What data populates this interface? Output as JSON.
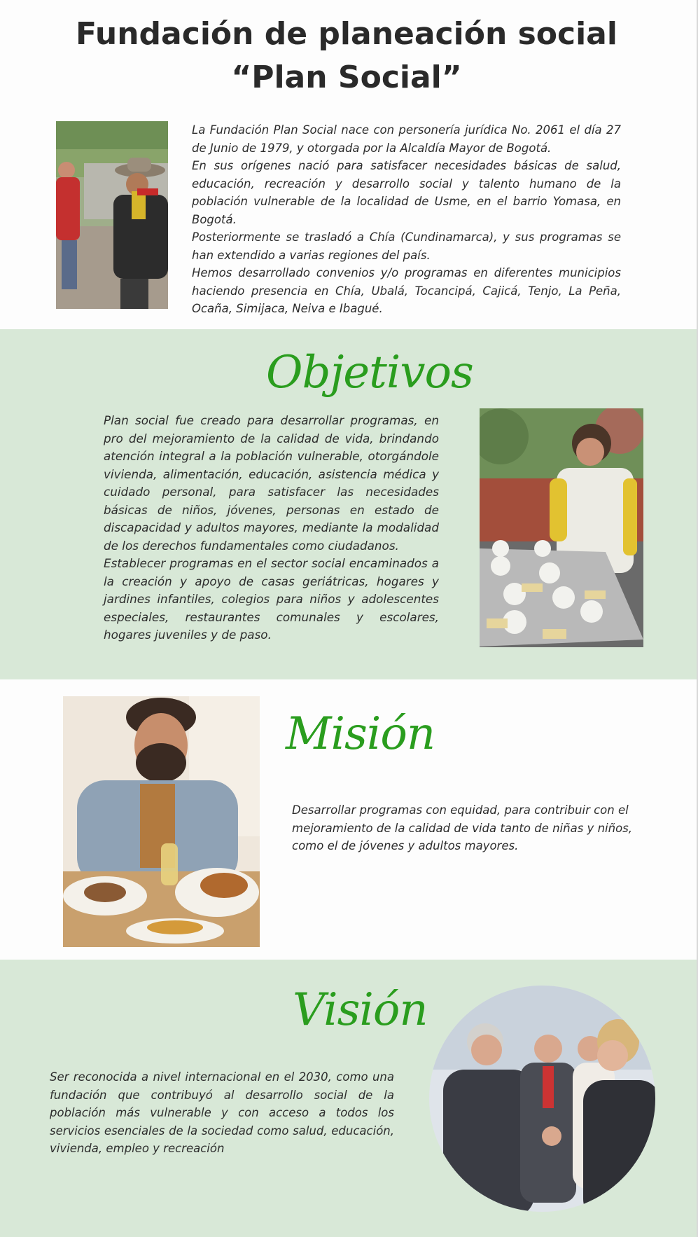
{
  "header": {
    "title_line1": "Fundación de planeación social",
    "title_line2": "“Plan Social”",
    "paragraphs": [
      "La Fundación Plan Social nace con personería jurídica No. 2061 el día 27 de Junio de 1979, y otorgada por la Alcaldía Mayor de Bogotá.",
      "En sus orígenes nació para satisfacer necesidades básicas de salud, educación, recreación y desarrollo social y talento humano de la población vulnerable de la localidad de Usme, en el barrio Yomasa, en Bogotá.",
      "Posteriormente se trasladó a Chía (Cundinamarca), y sus programas se han extendido a varias regiones del país.",
      "Hemos desarrollado convenios y/o programas en diferentes municipios haciendo presencia en Chía, Ubalá, Tocancipá, Cajicá, Tenjo, La Peña, Ocaña, Simijaca, Neiva e Ibagué."
    ]
  },
  "objetivos": {
    "title": "Objetivos",
    "paragraphs": [
      "Plan social fue creado para desarrollar programas, en pro del mejoramiento de la calidad de vida, brindando atención integral a la población vulnerable, otorgándole vivienda, alimentación, educación, asistencia médica y cuidado personal, para satisfacer las necesidades básicas de niños, jóvenes, personas en estado de discapacidad y adultos mayores, mediante la modalidad de los derechos fundamentales como ciudadanos.",
      "Establecer programas en el sector social encaminados a la creación y apoyo de casas geriátricas, hogares y jardines infantiles, colegios para niños y adolescentes especiales, restaurantes comunales y escolares, hogares juveniles y de paso."
    ]
  },
  "mision": {
    "title": "Misión",
    "text": "Desarrollar programas con equidad, para contribuir con el mejoramiento de la calidad de vida tanto de niñas y niños, como el de jóvenes y adultos mayores."
  },
  "vision": {
    "title": "Visión",
    "text": "Ser reconocida a nivel internacional en el 2030, como una fundación que contribuyó al desarrollo social de la población más vulnerable y con acceso a todos los servicios esenciales de la sociedad como salud, educación, vivienda, empleo y recreación"
  },
  "colors": {
    "accent_green": "#2a9d1e",
    "band_green": "#d8e8d7",
    "text": "#2d2d2d"
  }
}
